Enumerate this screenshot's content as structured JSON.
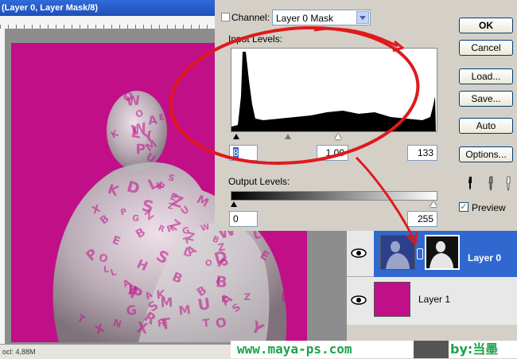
{
  "document": {
    "title": "(Layer 0, Layer Mask/8)",
    "status": "ocl: 4,88M",
    "canvas_color": "#c10f88",
    "letters": [
      "A",
      "Z",
      "M",
      "S",
      "P",
      "K",
      "O",
      "W",
      "R",
      "T",
      "X",
      "H",
      "N",
      "E",
      "Y",
      "L",
      "G",
      "D",
      "U",
      "B"
    ]
  },
  "levels": {
    "channel_label": "Channel:",
    "channel_value": "Layer 0 Mask",
    "input_levels_label": "Input Levels:",
    "input_black": "8",
    "input_gamma": "1,00",
    "input_white": "133",
    "output_levels_label": "Output Levels:",
    "output_black": "0",
    "output_white": "255",
    "buttons": {
      "ok": "OK",
      "cancel": "Cancel",
      "load": "Load...",
      "save": "Save...",
      "auto": "Auto",
      "options": "Options..."
    },
    "preview_label": "Preview",
    "preview_checked": true
  },
  "layers": {
    "items": [
      {
        "name": "Layer 0",
        "selected": true,
        "highlight_color": "#3168d0"
      },
      {
        "name": "Layer 1",
        "selected": false,
        "fill_color": "#c10f88"
      }
    ]
  },
  "watermark": {
    "url": "www.maya-ps.com",
    "by": "by:当墨"
  }
}
